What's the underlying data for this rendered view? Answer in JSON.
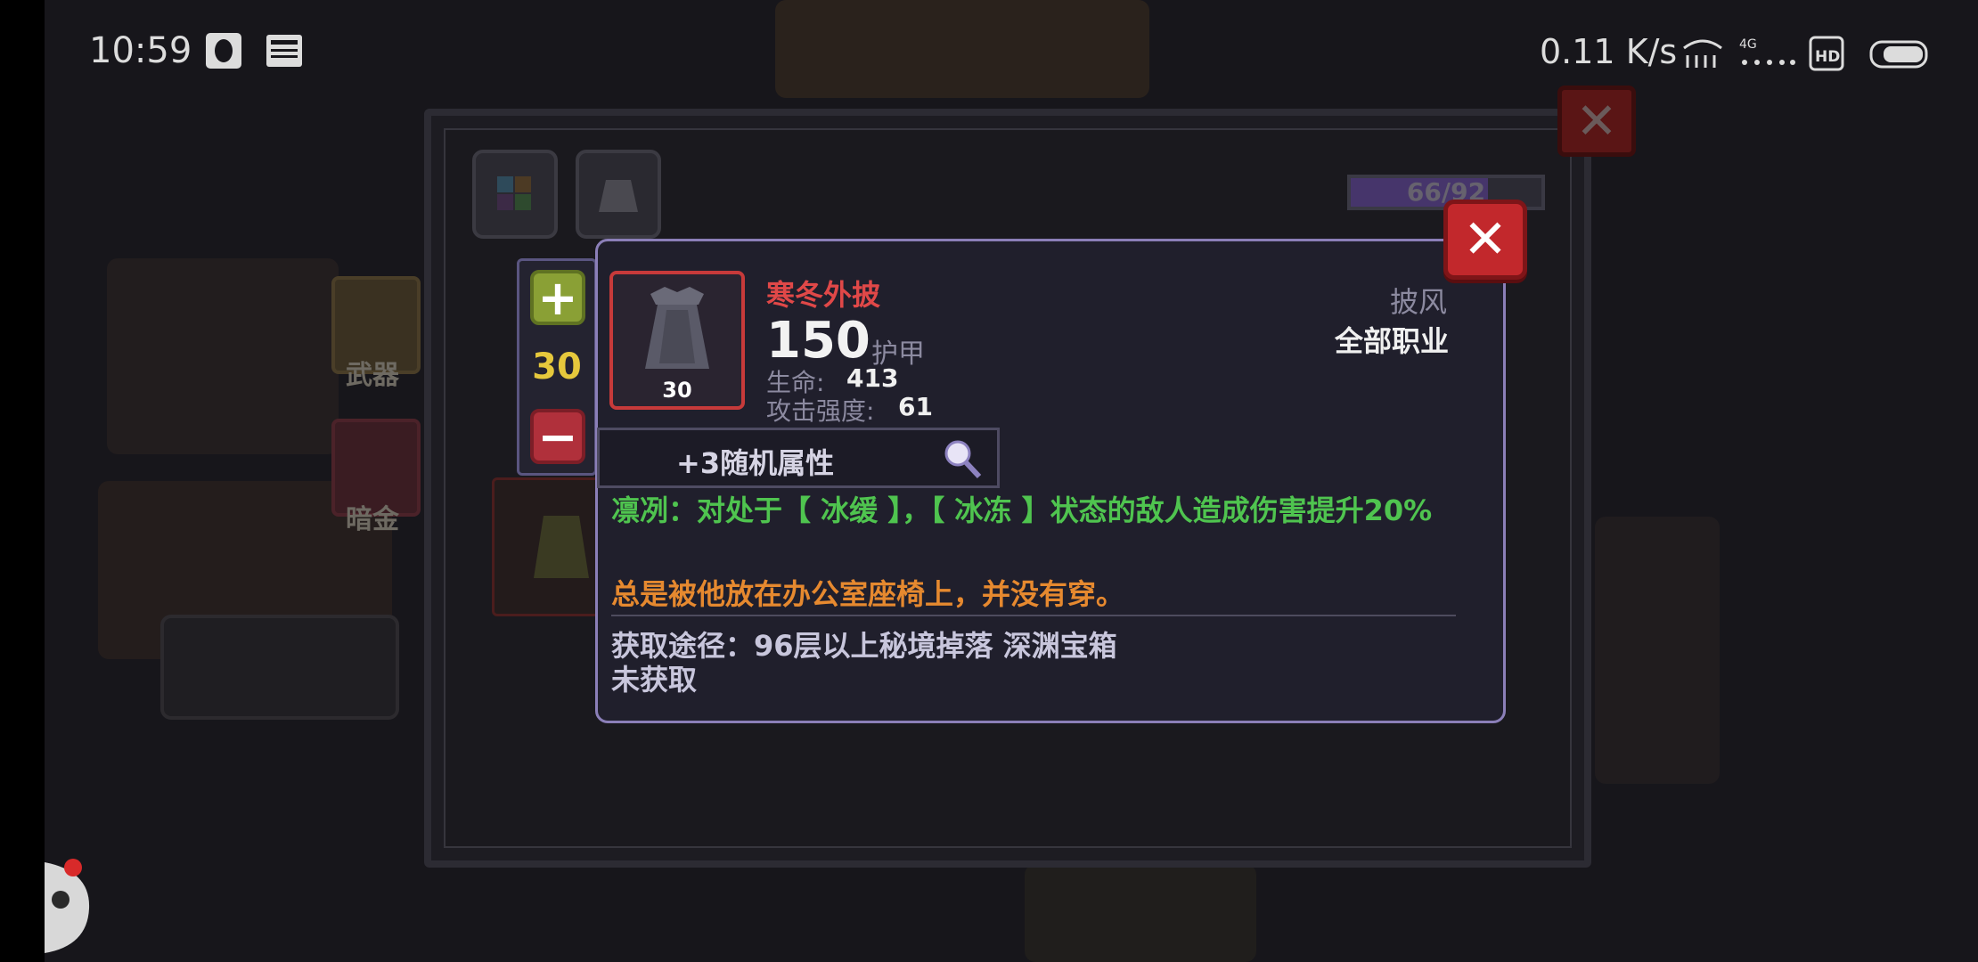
{
  "status_bar": {
    "time": "10:59",
    "speed": "0.11 K/s",
    "icons": [
      "qq-icon",
      "news-icon",
      "wifi-icon",
      "signal-4g-icon",
      "hd-icon",
      "battery-icon"
    ]
  },
  "main_panel": {
    "progress_text": "66/92",
    "progress_fraction": 0.72,
    "side_buttons": [
      {
        "label": "武器"
      },
      {
        "label": "暗金"
      }
    ]
  },
  "level_stepper": {
    "value": "30"
  },
  "item": {
    "name": "寒冬外披",
    "armor_value": "150",
    "armor_label": "护甲",
    "level": "30",
    "type": "披风",
    "class_restriction": "全部职业",
    "stats": [
      {
        "label": "生命:",
        "value": "413"
      },
      {
        "label": "攻击强度:",
        "value": "61"
      }
    ],
    "random_attributes": "+3随机属性",
    "effect": "凛冽：对处于【 冰缓 】，【 冰冻 】状态的敌人造成伤害提升20%",
    "flavor": "总是被他放在办公室座椅上，并没有穿。",
    "source": "获取途径：96层以上秘境掉落 深渊宝箱",
    "status": "未获取"
  },
  "colors": {
    "item_name": "#e04848",
    "effect": "#4fc44f",
    "flavor": "#e6892f",
    "level": "#e6c83c",
    "close_button": "#c2282c"
  }
}
